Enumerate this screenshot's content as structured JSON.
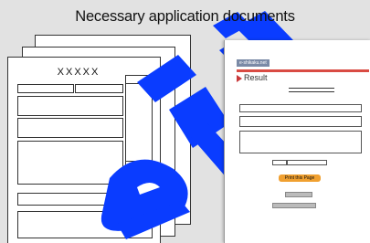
{
  "header": {
    "title": "Necessary application documents"
  },
  "form_document": {
    "placeholder_text": "XXXXX"
  },
  "result_page": {
    "url_badge": "e-shikaku.net",
    "heading": "Result",
    "print_button_label": "Print this Page"
  },
  "watermark": {
    "text": "ete",
    "color": "#0a3cff"
  },
  "colors": {
    "accent_red": "#d94b43",
    "print_button": "#f0a030",
    "url_badge": "#7a8aa6"
  }
}
